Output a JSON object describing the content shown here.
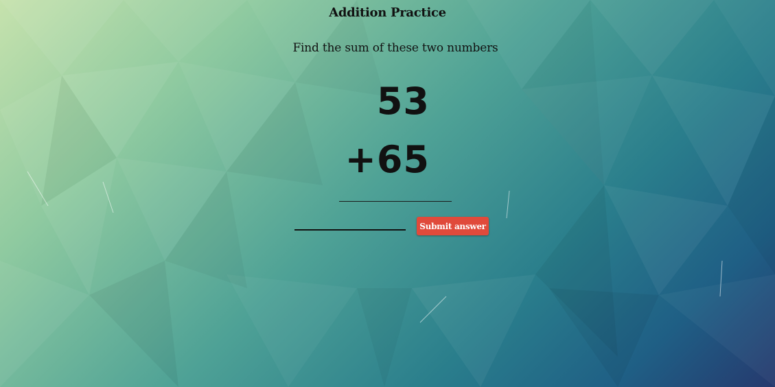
{
  "page": {
    "title": "Addition Practice",
    "instructions": "Find the sum of these two numbers"
  },
  "problem": {
    "first_number": "53",
    "second_number": "+65"
  },
  "answer": {
    "value": "",
    "placeholder": ""
  },
  "actions": {
    "submit_label": "Submit answer"
  },
  "colors": {
    "submit_button": "#e04a3b",
    "text": "#111111"
  }
}
